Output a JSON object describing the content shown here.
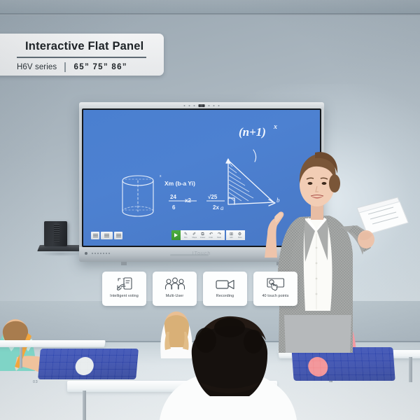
{
  "banner": {
    "title": "Interactive Flat  Panel",
    "series": "H6V series",
    "sizes": "65”  75”  86”"
  },
  "display": {
    "brand_mark": "ITouch",
    "camera_icon": "camera-icon",
    "whiteboard": {
      "cylinder_label": "cylinder-diagram",
      "expr_1": "Xm (b-a Yi)",
      "frac_num": "24",
      "frac_den": "6",
      "frac_mult": "x2",
      "radical": "√25",
      "radical_den": "2x",
      "exponent_expr": "(n+1)",
      "exponent_power": "x",
      "triangle_vertex_a": "a",
      "triangle_vertex_b": "b"
    },
    "left_buttons": [
      {
        "name": "screen-menu-button"
      },
      {
        "name": "screen-apps-button"
      },
      {
        "name": "screen-window-button"
      }
    ],
    "toolbar": {
      "play_label": "play-icon",
      "items": [
        {
          "icon": "✎",
          "label": "Pen",
          "name": "tool-pen"
        },
        {
          "icon": "✐",
          "label": "Shape",
          "name": "tool-shape"
        },
        {
          "icon": "⧉",
          "label": "Eraser",
          "name": "tool-eraser"
        },
        {
          "icon": "↶",
          "label": "Undo",
          "name": "tool-undo"
        },
        {
          "icon": "↷",
          "label": "Redo",
          "name": "tool-redo"
        }
      ],
      "items_right": [
        {
          "icon": "⊞",
          "label": "Add",
          "name": "tool-add"
        },
        {
          "icon": "⚙",
          "label": "More",
          "name": "tool-more"
        }
      ]
    }
  },
  "features": [
    {
      "label": "Intelligent voting",
      "icon": "hand-tablet-vote-icon",
      "name": "feature-intelligent-voting"
    },
    {
      "label": "Multi-User",
      "icon": "three-people-icon",
      "name": "feature-multi-user"
    },
    {
      "label": "Recording",
      "icon": "video-camera-icon",
      "name": "feature-recording"
    },
    {
      "label": "40 touch points",
      "icon": "hand-touch-screen-icon",
      "name": "feature-touch-points"
    }
  ],
  "page": {
    "number": "03"
  },
  "colors": {
    "screen_blue": "#4a7fd0",
    "chair_blue": "#2f47b4",
    "wall": "#aab6bf",
    "banner_bg": "#f2f3f4",
    "accent_green": "#4cae3f"
  }
}
